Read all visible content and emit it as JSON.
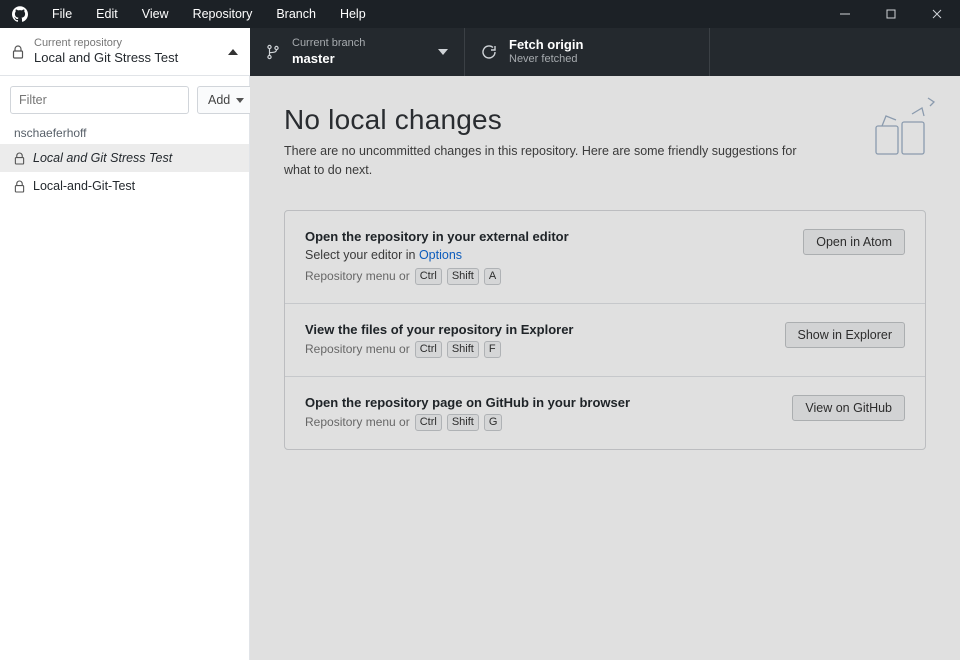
{
  "menus": {
    "file": "File",
    "edit": "Edit",
    "view": "View",
    "repository": "Repository",
    "branch": "Branch",
    "help": "Help"
  },
  "toolbar": {
    "repo": {
      "label": "Current repository",
      "value": "Local and Git Stress Test"
    },
    "branch": {
      "label": "Current branch",
      "value": "master"
    },
    "fetch": {
      "label": "Fetch origin",
      "value": "Never fetched"
    }
  },
  "sidebar": {
    "filter_placeholder": "Filter",
    "add_label": "Add",
    "group": "nschaeferhoff",
    "items": [
      {
        "name": "Local and Git Stress Test"
      },
      {
        "name": "Local-and-Git-Test"
      }
    ]
  },
  "main": {
    "headline": "No local changes",
    "subtext": "There are no uncommitted changes in this repository. Here are some friendly suggestions for what to do next.",
    "menu_prefix": "Repository menu or",
    "cards": [
      {
        "title": "Open the repository in your external editor",
        "subtext_pre": "Select your editor in ",
        "subtext_link": "Options",
        "keys": [
          "Ctrl",
          "Shift",
          "A"
        ],
        "button": "Open in Atom"
      },
      {
        "title": "View the files of your repository in Explorer",
        "keys": [
          "Ctrl",
          "Shift",
          "F"
        ],
        "button": "Show in Explorer"
      },
      {
        "title": "Open the repository page on GitHub in your browser",
        "keys": [
          "Ctrl",
          "Shift",
          "G"
        ],
        "button": "View on GitHub"
      }
    ]
  }
}
